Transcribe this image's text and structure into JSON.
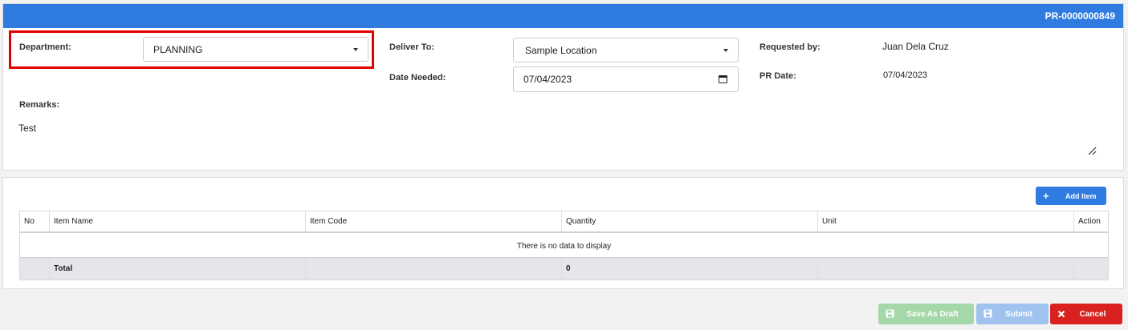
{
  "header": {
    "pr_number": "PR-0000000849"
  },
  "form": {
    "department_label": "Department:",
    "department_value": "PLANNING",
    "deliver_to_label": "Deliver To:",
    "deliver_to_value": "Sample Location",
    "date_needed_label": "Date Needed:",
    "date_needed_value": "07/04/2023",
    "requested_by_label": "Requested by:",
    "requested_by_value": "Juan Dela Cruz",
    "pr_date_label": "PR Date:",
    "pr_date_value": "07/04/2023",
    "remarks_label": "Remarks:",
    "remarks_value": "Test"
  },
  "items": {
    "add_button_label": "Add Item",
    "columns": [
      "No",
      "Item Name",
      "Item Code",
      "Quantity",
      "Unit",
      "Action"
    ],
    "empty_text": "There is no data to display",
    "total_label": "Total",
    "total_quantity": "0"
  },
  "footer": {
    "save_draft_label": "Save As Draft",
    "submit_label": "Submit",
    "cancel_label": "Cancel"
  },
  "icons": {
    "dropdown": "caret-down-icon",
    "calendar": "calendar-icon",
    "resize": "resize-handle-icon",
    "add": "plus-icon",
    "save": "floppy-disk-icon",
    "cancel": "close-icon"
  },
  "colors": {
    "accent": "#2f7be0",
    "highlight": "#e00000",
    "cancel": "#d9211f",
    "draft": "#a5d8a8",
    "submit": "#9fc3ee"
  }
}
